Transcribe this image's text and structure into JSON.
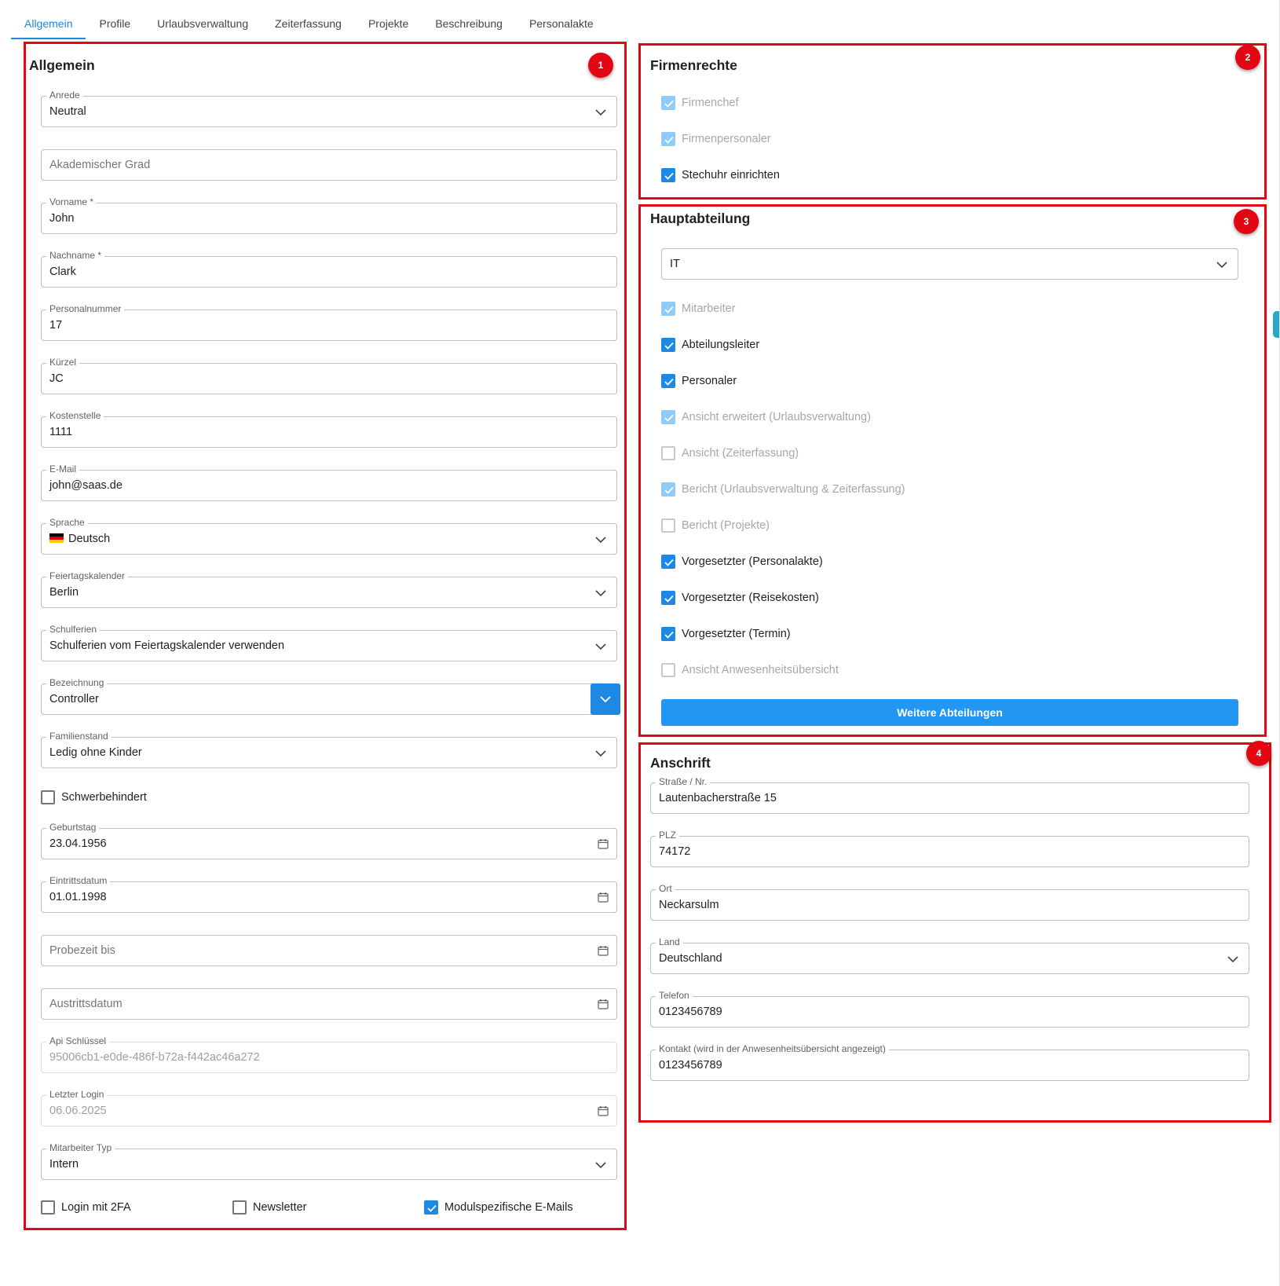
{
  "tabs": [
    {
      "label": "Allgemein"
    },
    {
      "label": "Profile"
    },
    {
      "label": "Urlaubsverwaltung"
    },
    {
      "label": "Zeiterfassung"
    },
    {
      "label": "Projekte"
    },
    {
      "label": "Beschreibung"
    },
    {
      "label": "Personalakte"
    }
  ],
  "badges": [
    "1",
    "2",
    "3",
    "4"
  ],
  "allgemein": {
    "title": "Allgemein",
    "anrede": {
      "label": "Anrede",
      "value": "Neutral"
    },
    "akad_grad": {
      "placeholder": "Akademischer Grad"
    },
    "vorname": {
      "label": "Vorname *",
      "value": "John"
    },
    "nachname": {
      "label": "Nachname *",
      "value": "Clark"
    },
    "personalnummer": {
      "label": "Personalnummer",
      "value": "17"
    },
    "kuerzel": {
      "label": "Kürzel",
      "value": "JC"
    },
    "kostenstelle": {
      "label": "Kostenstelle",
      "value": "1111"
    },
    "email": {
      "label": "E-Mail",
      "value": "john@saas.de"
    },
    "sprache": {
      "label": "Sprache",
      "value": "Deutsch"
    },
    "feiertagskalender": {
      "label": "Feiertagskalender",
      "value": "Berlin"
    },
    "schulferien": {
      "label": "Schulferien",
      "value": "Schulferien vom Feiertagskalender verwenden"
    },
    "bezeichnung": {
      "label": "Bezeichnung",
      "value": "Controller"
    },
    "familienstand": {
      "label": "Familienstand",
      "value": "Ledig ohne Kinder"
    },
    "schwerbehindert": {
      "label": "Schwerbehindert",
      "checked": false
    },
    "geburtstag": {
      "label": "Geburtstag",
      "value": "23.04.1956"
    },
    "eintrittsdatum": {
      "label": "Eintrittsdatum",
      "value": "01.01.1998"
    },
    "probezeit": {
      "placeholder": "Probezeit bis"
    },
    "austrittsdatum": {
      "placeholder": "Austrittsdatum"
    },
    "api_key": {
      "label": "Api Schlüssel",
      "value": "95006cb1-e0de-486f-b72a-f442ac46a272"
    },
    "letzter_login": {
      "label": "Letzter Login",
      "value": "06.06.2025"
    },
    "mitarbeiter_typ": {
      "label": "Mitarbeiter Typ",
      "value": "Intern"
    },
    "login_2fa": {
      "label": "Login mit 2FA",
      "checked": false
    },
    "newsletter": {
      "label": "Newsletter",
      "checked": false
    },
    "modul_emails": {
      "label": "Modulspezifische E-Mails",
      "checked": true
    }
  },
  "firmenrechte": {
    "title": "Firmenrechte",
    "items": [
      {
        "label": "Firmenchef",
        "checked": true,
        "disabled": true
      },
      {
        "label": "Firmenpersonaler",
        "checked": true,
        "disabled": true
      },
      {
        "label": "Stechuhr einrichten",
        "checked": true,
        "disabled": false
      }
    ]
  },
  "hauptabteilung": {
    "title": "Hauptabteilung",
    "select_value": "IT",
    "items": [
      {
        "label": "Mitarbeiter",
        "checked": true,
        "disabled": true
      },
      {
        "label": "Abteilungsleiter",
        "checked": true,
        "disabled": false
      },
      {
        "label": "Personaler",
        "checked": true,
        "disabled": false
      },
      {
        "label": "Ansicht erweitert (Urlaubsverwaltung)",
        "checked": true,
        "disabled": true
      },
      {
        "label": "Ansicht (Zeiterfassung)",
        "checked": false,
        "disabled": true
      },
      {
        "label": "Bericht (Urlaubsverwaltung & Zeiterfassung)",
        "checked": true,
        "disabled": true
      },
      {
        "label": "Bericht (Projekte)",
        "checked": false,
        "disabled": true
      },
      {
        "label": "Vorgesetzter (Personalakte)",
        "checked": true,
        "disabled": false
      },
      {
        "label": "Vorgesetzter (Reisekosten)",
        "checked": true,
        "disabled": false
      },
      {
        "label": "Vorgesetzter (Termin)",
        "checked": true,
        "disabled": false
      },
      {
        "label": "Ansicht Anwesenheitsübersicht",
        "checked": false,
        "disabled": true
      }
    ],
    "button": "Weitere Abteilungen"
  },
  "anschrift": {
    "title": "Anschrift",
    "strasse": {
      "label": "Straße / Nr.",
      "value": "Lautenbacherstraße 15"
    },
    "plz": {
      "label": "PLZ",
      "value": "74172"
    },
    "ort": {
      "label": "Ort",
      "value": "Neckarsulm"
    },
    "land": {
      "label": "Land",
      "value": "Deutschland"
    },
    "telefon": {
      "label": "Telefon",
      "value": "0123456789"
    },
    "kontakt": {
      "label": "Kontakt (wird in der Anwesenheitsübersicht angezeigt)",
      "value": "0123456789"
    }
  },
  "colors": {
    "accent": "#1e88e5",
    "highlight": "#e30613"
  }
}
